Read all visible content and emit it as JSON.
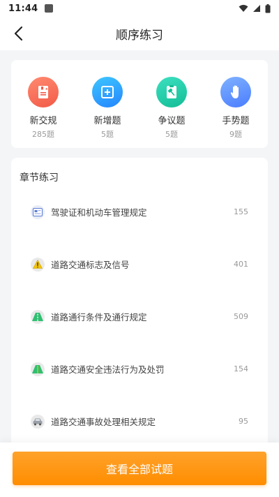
{
  "status_bar": {
    "time": "11:44",
    "icons": [
      "notification-icon",
      "wifi-icon",
      "signal-icon",
      "battery-icon"
    ]
  },
  "header": {
    "title": "顺序练习",
    "back_icon": "back-arrow-icon"
  },
  "quick_entries": [
    {
      "label": "新交规",
      "count": "285题",
      "icon": "new-rules-book-icon",
      "color": "#ff6e5a"
    },
    {
      "label": "新增题",
      "count": "5题",
      "icon": "plus-square-icon",
      "color": "#2f9bff"
    },
    {
      "label": "争议题",
      "count": "5题",
      "icon": "gavel-icon",
      "color": "#1ccfa8"
    },
    {
      "label": "手势题",
      "count": "9题",
      "icon": "hand-icon",
      "color": "#5a8dff"
    }
  ],
  "chapter_section": {
    "title": "章节练习",
    "items": [
      {
        "name": "驾驶证和机动车管理规定",
        "count": "155",
        "icon": "license-card-icon"
      },
      {
        "name": "道路交通标志及信号",
        "count": "401",
        "icon": "warning-sign-icon"
      },
      {
        "name": "道路通行条件及通行规定",
        "count": "509",
        "icon": "road-icon"
      },
      {
        "name": "道路交通安全违法行为及处罚",
        "count": "154",
        "icon": "road-violation-icon"
      },
      {
        "name": "道路交通事故处理相关规定",
        "count": "95",
        "icon": "car-accident-icon"
      }
    ]
  },
  "bottom": {
    "button_label": "查看全部试题"
  },
  "colors": {
    "accent": "#ff8d00",
    "background": "#f4f5f7"
  }
}
